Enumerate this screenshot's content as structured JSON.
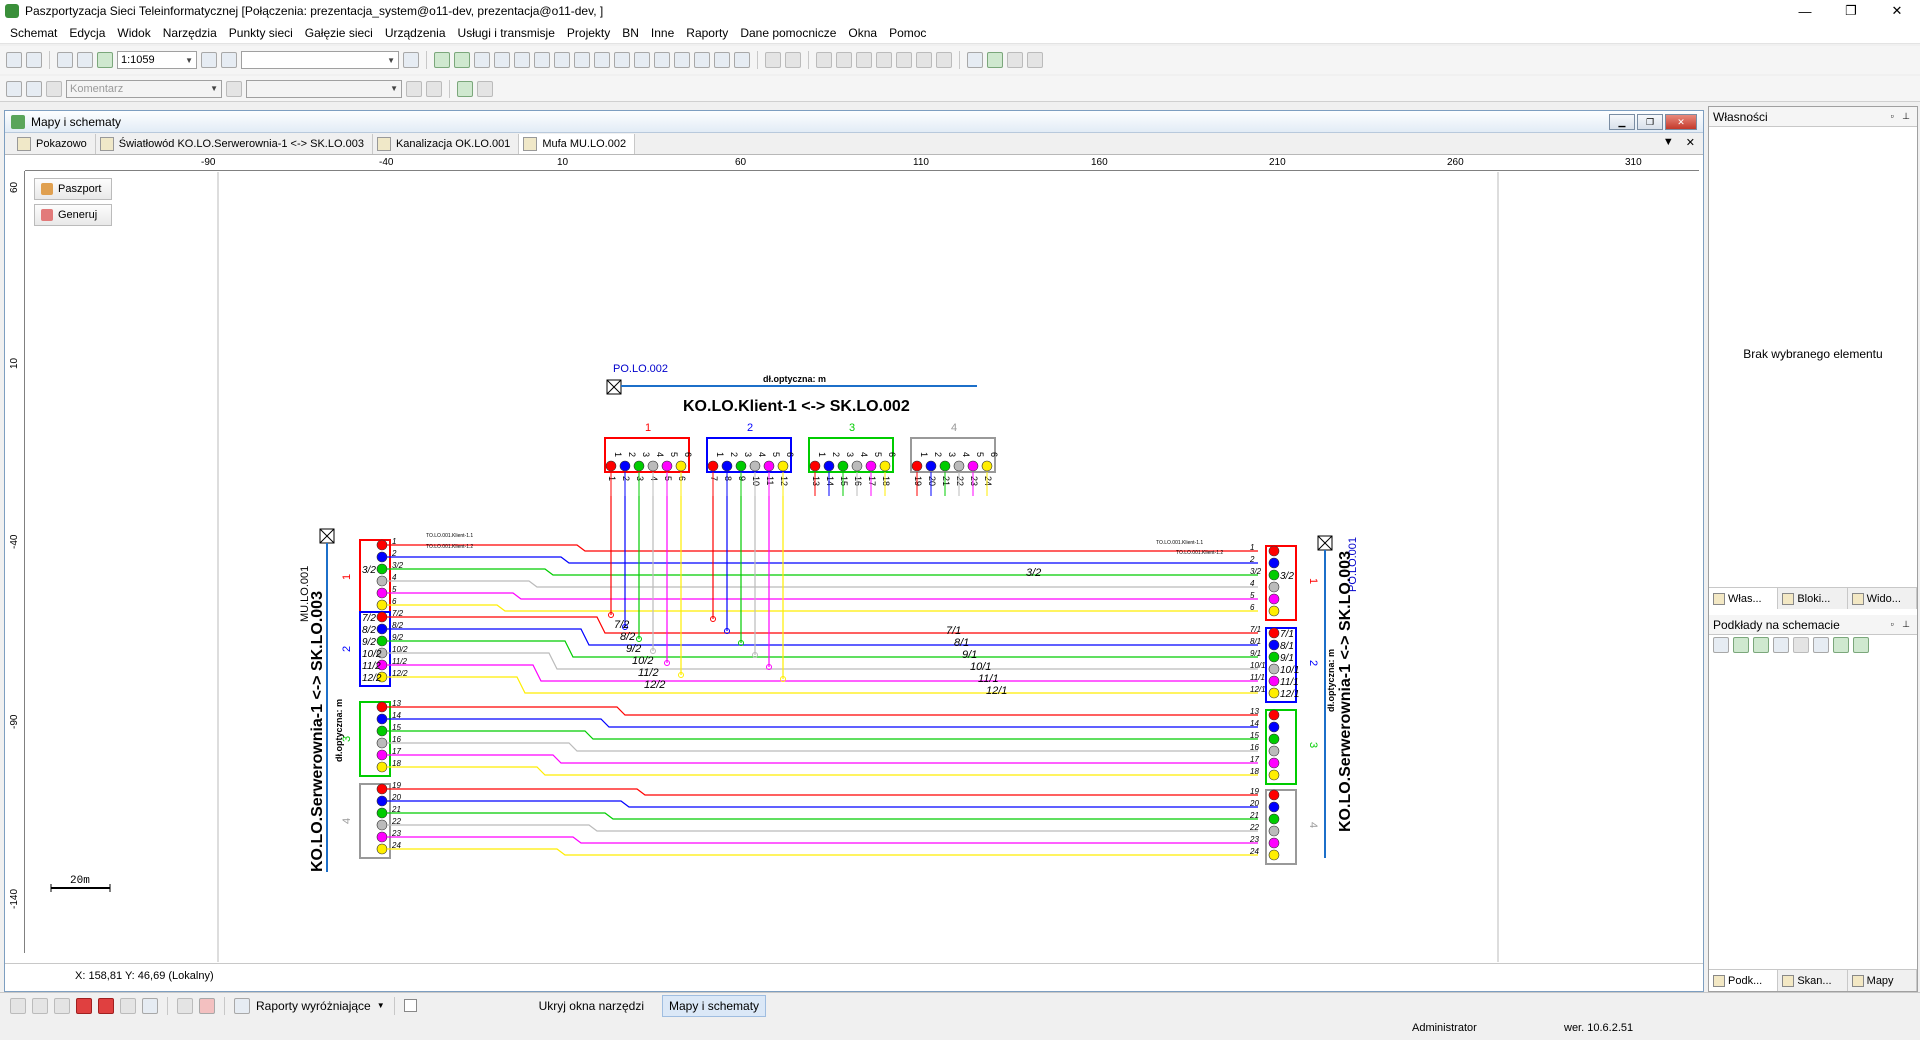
{
  "app": {
    "title": "Paszportyzacja Sieci Teleinformatycznej [Połączenia: prezentacja_system@o11-dev, prezentacja@o11-dev, ]"
  },
  "window_controls": {
    "minimize": "—",
    "maximize": "❐",
    "close": "✕"
  },
  "menu": [
    "Schemat",
    "Edycja",
    "Widok",
    "Narzędzia",
    "Punkty sieci",
    "Gałęzie sieci",
    "Urządzenia",
    "Usługi i transmisje",
    "Projekty",
    "BN",
    "Inne",
    "Raporty",
    "Dane pomocnicze",
    "Okna",
    "Pomoc"
  ],
  "toolbar": {
    "scale": "1:1059",
    "layer_combo": "",
    "comment_placeholder": "Komentarz"
  },
  "mdi": {
    "title": "Mapy i schematy",
    "tabs": [
      "Pokazowo",
      "Światłowód KO.LO.Serwerownia-1 <-> SK.LO.003",
      "Kanalizacja OK.LO.001",
      "Mufa MU.LO.002"
    ]
  },
  "ruler_h": [
    "-90",
    "-40",
    "10",
    "60",
    "110",
    "160",
    "210",
    "260",
    "310"
  ],
  "ruler_v": [
    "60",
    "10",
    "-40",
    "-90",
    "-140"
  ],
  "side_buttons": {
    "passport": "Paszport",
    "generate": "Generuj"
  },
  "coords": "X: 158,81  Y: 46,69 (Lokalny)",
  "scale_bar": "20m",
  "schematic": {
    "top_label": "PO.LO.002",
    "top_len": "dł.optyczna:  m",
    "top_title": "KO.LO.Klient-1 <-> SK.LO.002",
    "left_box": "MU.LO.001",
    "left_title": "KO.LO.Serwerownia-1 <-> SK.LO.003",
    "left_len": "dł.optyczna:  m",
    "right_box": "PO.LO.001",
    "right_title": "KO.LO.Serwerownia-1 <-> SK.LO.003",
    "right_len": "dł.optyczna:  m",
    "tube_numbers": [
      "1",
      "2",
      "3",
      "4"
    ],
    "left_fibers": [
      [
        "1",
        "2",
        "3/2",
        "4",
        "5",
        "6"
      ],
      [
        "7/2",
        "8/2",
        "9/2",
        "10/2",
        "11/2",
        "12/2"
      ],
      [
        "13",
        "14",
        "15",
        "16",
        "17",
        "18"
      ],
      [
        "19",
        "20",
        "21",
        "22",
        "23",
        "24"
      ]
    ],
    "left_inner": [
      [
        "",
        "",
        "3/2",
        "",
        "",
        ""
      ],
      [
        "7/2",
        "8/2",
        "9/2",
        "10/2",
        "11/2",
        "12/2"
      ]
    ],
    "right_fibers": [
      [
        "1",
        "2",
        "3/2",
        "4",
        "5",
        "6"
      ],
      [
        "7/1",
        "8/1",
        "9/1",
        "10/1",
        "11/1",
        "12/1"
      ],
      [
        "13",
        "14",
        "15",
        "16",
        "17",
        "18"
      ],
      [
        "19",
        "20",
        "21",
        "22",
        "23",
        "24"
      ]
    ],
    "right_inner": [
      [
        "",
        "",
        "3/2",
        "",
        "",
        ""
      ],
      [
        "7/1",
        "8/1",
        "9/1",
        "10/1",
        "11/1",
        "12/1"
      ]
    ],
    "top_fiber_nums": [
      "1",
      "2",
      "3",
      "4",
      "5",
      "6",
      "7",
      "8",
      "9",
      "10",
      "11",
      "12",
      "13",
      "14",
      "15",
      "16",
      "17",
      "18",
      "19",
      "20",
      "21",
      "22",
      "23",
      "24"
    ],
    "mid_labels_left": [
      "7/2",
      "8/2",
      "9/2",
      "10/2",
      "11/2",
      "12/2"
    ],
    "mid_labels_right": [
      "7/1",
      "8/1",
      "9/1",
      "10/1",
      "11/1",
      "12/1"
    ],
    "mid_label_tube1": "3/2",
    "small_left": [
      "TO.LO.001.Klient-1.1",
      "TO.LO.001.Klient-1.2"
    ],
    "small_right": [
      "TO.LO.001.Klient-1.1",
      "TO.LO.001.Klient-1.2"
    ]
  },
  "colors": {
    "red": "#ff0000",
    "blue": "#0000ff",
    "green": "#00cc00",
    "gray": "#bbbbbb",
    "magenta": "#ff00ff",
    "yellow": "#ffee00"
  },
  "right_panel": {
    "props_title": "Własności",
    "empty": "Brak wybranego elementu",
    "tabs1": [
      "Włas...",
      "Bloki...",
      "Wido..."
    ],
    "underlays_title": "Podkłady na schemacie",
    "tabs2": [
      "Podk...",
      "Skan...",
      "Mapy"
    ]
  },
  "bottom": {
    "reports": "Raporty wyróżniające",
    "hide": "Ukryj okna narzędzi",
    "maps": "Mapy i schematy"
  },
  "status": {
    "user": "Administrator",
    "version": "wer. 10.6.2.51"
  }
}
